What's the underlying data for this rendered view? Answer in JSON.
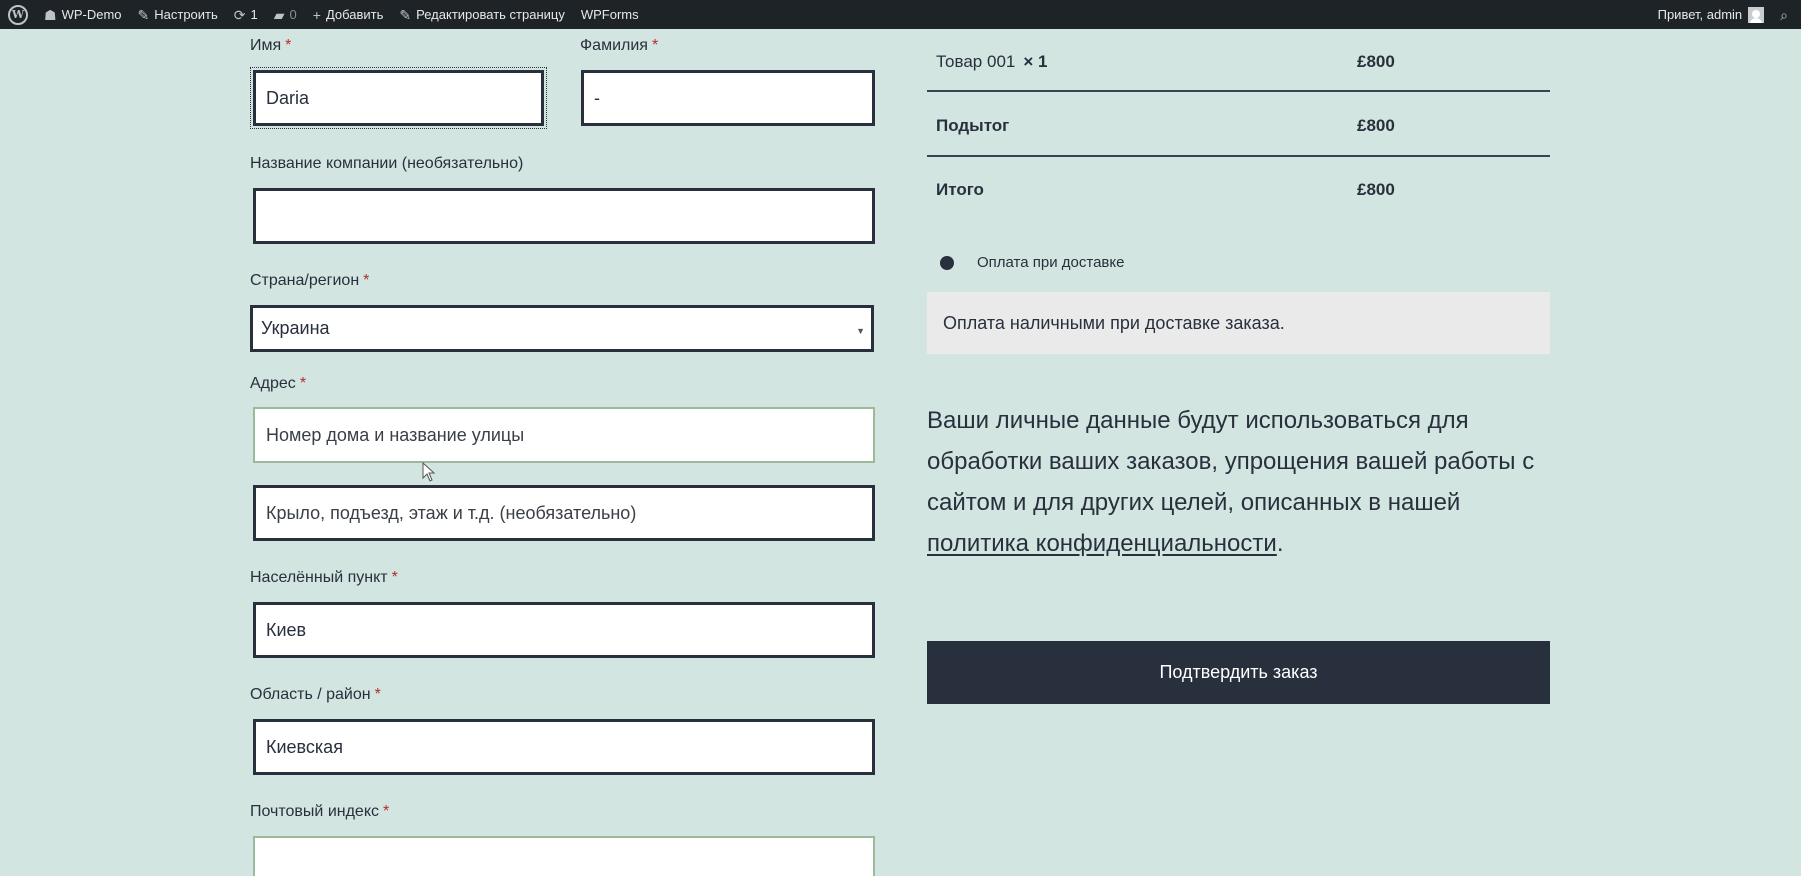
{
  "adminbar": {
    "site_name": "WP-Demo",
    "customize": "Настроить",
    "updates_count": "1",
    "comments_count": "0",
    "add_new": "Добавить",
    "edit_page": "Редактировать страницу",
    "wpforms": "WPForms",
    "greeting": "Привет, admin"
  },
  "billing": {
    "first_name": {
      "label": "Имя",
      "required": "*",
      "value": "Daria"
    },
    "last_name": {
      "label": "Фамилия",
      "required": "*",
      "value": "-"
    },
    "company": {
      "label": "Название компании (необязательно)",
      "value": ""
    },
    "country": {
      "label": "Страна/регион",
      "required": "*",
      "value": "Украина"
    },
    "address": {
      "label": "Адрес",
      "required": "*",
      "placeholder_1": "Номер дома и название улицы",
      "placeholder_2": "Крыло, подъезд, этаж и т.д. (необязательно)"
    },
    "city": {
      "label": "Населённый пункт",
      "required": "*",
      "value": "Киев"
    },
    "state": {
      "label": "Область / район",
      "required": "*",
      "value": "Киевская"
    },
    "postcode": {
      "label": "Почтовый индекс",
      "required": "*",
      "value": ""
    }
  },
  "order": {
    "item_name": "Товар 001",
    "item_qty": "× 1",
    "item_price": "£800",
    "subtotal_label": "Подытог",
    "subtotal_value": "£800",
    "total_label": "Итого",
    "total_value": "£800"
  },
  "payment": {
    "method_label": "Оплата при доставке",
    "description": "Оплата наличными при доставке заказа."
  },
  "privacy": {
    "text": "Ваши личные данные будут использоваться для обработки ваших заказов, упрощения вашей работы с сайтом и для других целей, описанных в нашей",
    "link": "политика конфиденциальности",
    "end": "."
  },
  "submit_label": "Подтвердить заказ"
}
